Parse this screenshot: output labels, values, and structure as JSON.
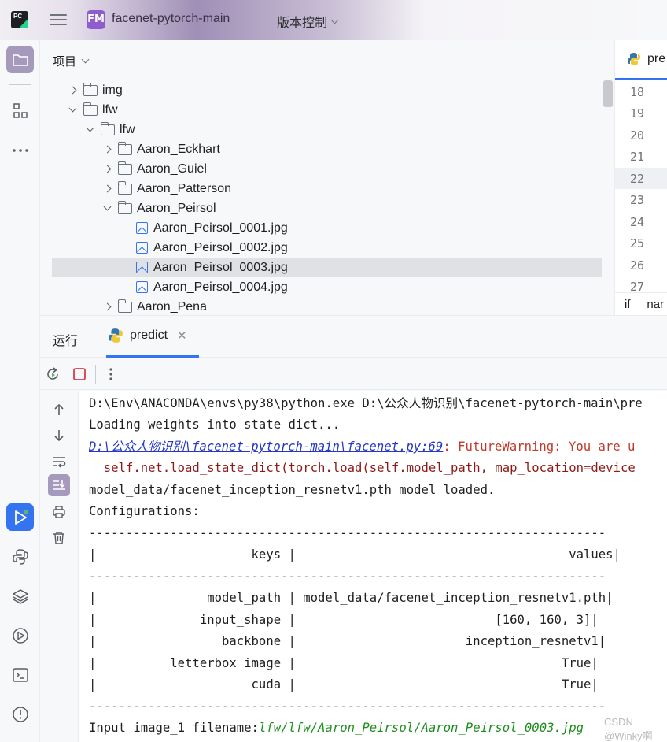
{
  "titlebar": {
    "project_badge": "FM",
    "project_name": "facenet-pytorch-main",
    "vcs_label": "版本控制"
  },
  "left_strip": {
    "icons": [
      "project-folder-icon",
      "structure-icon",
      "more-icon",
      "run-icon",
      "python-console-icon",
      "layers-icon",
      "services-icon",
      "terminal-icon",
      "problems-icon"
    ]
  },
  "project_panel": {
    "title": "项目",
    "tree": [
      {
        "label": "img",
        "kind": "folder",
        "level": 1,
        "expanded": false
      },
      {
        "label": "lfw",
        "kind": "folder",
        "level": 1,
        "expanded": true
      },
      {
        "label": "lfw",
        "kind": "folder",
        "level": 2,
        "expanded": true
      },
      {
        "label": "Aaron_Eckhart",
        "kind": "folder",
        "level": 3,
        "expanded": false
      },
      {
        "label": "Aaron_Guiel",
        "kind": "folder",
        "level": 3,
        "expanded": false
      },
      {
        "label": "Aaron_Patterson",
        "kind": "folder",
        "level": 3,
        "expanded": false
      },
      {
        "label": "Aaron_Peirsol",
        "kind": "folder",
        "level": 3,
        "expanded": true
      },
      {
        "label": "Aaron_Peirsol_0001.jpg",
        "kind": "image",
        "level": 4
      },
      {
        "label": "Aaron_Peirsol_0002.jpg",
        "kind": "image",
        "level": 4
      },
      {
        "label": "Aaron_Peirsol_0003.jpg",
        "kind": "image",
        "level": 4,
        "selected": true
      },
      {
        "label": "Aaron_Peirsol_0004.jpg",
        "kind": "image",
        "level": 4
      },
      {
        "label": "Aaron_Pena",
        "kind": "folder",
        "level": 3,
        "expanded": false
      }
    ]
  },
  "editor": {
    "tab_label": "pre",
    "line_numbers": [
      "18",
      "19",
      "20",
      "21",
      "22",
      "23",
      "24",
      "25",
      "26",
      "27"
    ],
    "current_line": "22",
    "footer_text": "if __nar"
  },
  "run_panel": {
    "label": "运行",
    "tab_label": "predict",
    "console": {
      "line1": "D:\\Env\\ANACONDA\\envs\\py38\\python.exe D:\\公众人物识别\\facenet-pytorch-main\\pre",
      "line2": "Loading weights into state dict...",
      "line3_link": "D:\\公众人物识别\\facenet-pytorch-main\\facenet.py:69",
      "line3_rest": ": FutureWarning: You are u",
      "line4": "  self.net.load_state_dict(torch.load(self.model_path, map_location=device",
      "line5": "model_data/facenet_inception_resnetv1.pth model loaded.",
      "line6": "Configurations:",
      "sep": "----------------------------------------------------------------------",
      "header": "|                     keys |                                     values|",
      "rows": [
        "|               model_path | model_data/facenet_inception_resnetv1.pth|",
        "|              input_shape |                           [160, 160, 3]|",
        "|                 backbone |                       inception_resnetv1|",
        "|          letterbox_image |                                    True|",
        "|                     cuda |                                    True|"
      ],
      "last_prefix": "Input image_1 filename:",
      "last_path": "lfw/lfw/Aaron_Peirsol/Aaron_Peirsol_0003.jpg"
    },
    "watermark": "CSDN @Winky啊"
  }
}
